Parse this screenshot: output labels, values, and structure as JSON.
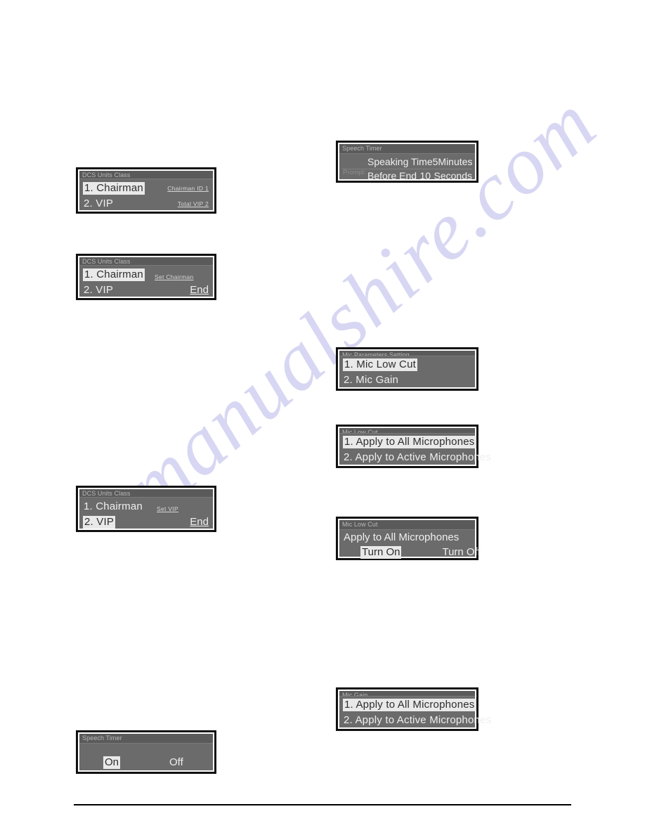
{
  "page": {
    "watermark": "manualshire.com",
    "background_color": "#ffffff",
    "panel_body_color": "#6b6b6b",
    "panel_title_color": "#5a5a5a",
    "panel_border_color": "#111111",
    "selected_bg_color": "#e9e9e9",
    "selected_text_color": "#2e2e2e",
    "text_color": "#efefef"
  },
  "panels": {
    "dcs_units_class_1": {
      "title": "DCS Units Class",
      "items": [
        {
          "label": "1. Chairman",
          "selected": true,
          "note": "Chairman ID  1"
        },
        {
          "label": "2. VIP",
          "selected": false,
          "note": "Total VIP     2"
        }
      ]
    },
    "dcs_units_class_2": {
      "title": "DCS Units Class",
      "items": [
        {
          "label": "1. Chairman",
          "selected": true,
          "note": "Set Chairman"
        },
        {
          "label": "2. VIP",
          "selected": false
        }
      ],
      "end_label": "End"
    },
    "dcs_units_class_3": {
      "title": "DCS Units Class",
      "items": [
        {
          "label": "1. Chairman",
          "selected": false,
          "note": "Set  VIP"
        },
        {
          "label": "2. VIP",
          "selected": true
        }
      ],
      "end_label": "End"
    },
    "speech_timer_toggle": {
      "title": "Speech Timer",
      "options": [
        {
          "label": "On",
          "selected": true
        },
        {
          "label": "Off",
          "selected": false
        }
      ]
    },
    "speech_timer_prompt": {
      "title": "Speech Timer",
      "prompt_label": "Prompt:",
      "rows": [
        {
          "name": "Speaking Time",
          "value": "5",
          "unit": "Minutes"
        },
        {
          "name": "Before End",
          "value": "10",
          "unit": "Seconds"
        }
      ]
    },
    "mic_parameters_setting": {
      "title": "Mic Parameters Setting",
      "items": [
        {
          "label": "1. Mic Low Cut",
          "selected": true
        },
        {
          "label": "2. Mic Gain",
          "selected": false
        }
      ]
    },
    "mic_low_cut_apply": {
      "title": "Mic Low Cut",
      "items": [
        {
          "label": "1. Apply to All Microphones",
          "selected": true
        },
        {
          "label": "2. Apply to Active Microphones",
          "selected": false
        }
      ]
    },
    "mic_low_cut_turn": {
      "title": "Mic Low Cut",
      "heading": "Apply to All Microphones",
      "options": [
        {
          "label": "Turn On",
          "selected": true
        },
        {
          "label": "Turn Off",
          "selected": false
        }
      ]
    },
    "mic_gain_apply": {
      "title": "Mic Gain",
      "items": [
        {
          "label": "1. Apply to All Microphones",
          "selected": true
        },
        {
          "label": "2. Apply to Active Microphones",
          "selected": false
        }
      ]
    }
  }
}
